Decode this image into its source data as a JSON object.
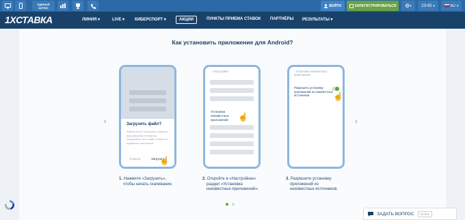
{
  "topbar": {
    "badge_line1": "ЕДИНЫЙ",
    "badge_line2": "ЦУПИС",
    "login_label": "ВОЙТИ",
    "register_label": "ЗАРЕГИСТРИРОВАТЬСЯ",
    "time": "23:43",
    "lang": "RU"
  },
  "nav": {
    "logo_prefix": "1X",
    "logo_suffix": "СТАВКА",
    "items": [
      "ЛИНИЯ",
      "LIVE",
      "КИБЕРСПОРТ",
      "АКЦИИ",
      "ПУНКТЫ ПРИЕМА СТАВОК",
      "ПАРТНЁРЫ",
      "РЕЗУЛЬТАТЫ"
    ]
  },
  "page": {
    "title": "Как установить приложение для Android?"
  },
  "phone1": {
    "dialog_title": "Загрузить файл?",
    "dialog_text": "Файлы этого типа могут нанести вред вашему телефону. Загружайте этот файл только из надежного источника.",
    "cancel": "Отмена",
    "download": "Загрузить"
  },
  "phone2": {
    "back_label": "Настройки",
    "option_label": "Установка неизвестных приложений"
  },
  "phone3": {
    "back_label": "Установка неизвестных приложений",
    "toggle_label": "Разрешить установку приложений из неизвестных источников"
  },
  "steps": [
    {
      "num": "1.",
      "text_lines": [
        "Нажмите «Загрузить»,",
        "чтобы начать скачивание."
      ]
    },
    {
      "num": "2.",
      "text_lines": [
        "Откройте в «Настройках»",
        "раздел «Установка",
        "неизвестных приложений»."
      ]
    },
    {
      "num": "3.",
      "text_lines": [
        "Разрешите установку",
        "приложений из",
        "неизвестных источников."
      ]
    }
  ],
  "chat": {
    "label": "ЗАДАТЬ ВОПРОС",
    "status": "on-line"
  },
  "colors": {
    "topbar": "#2b6aa7",
    "nav": "#19426b",
    "register": "#6aa341",
    "phone_frame": "#8bb6e0",
    "accent_green": "#5aa832"
  }
}
